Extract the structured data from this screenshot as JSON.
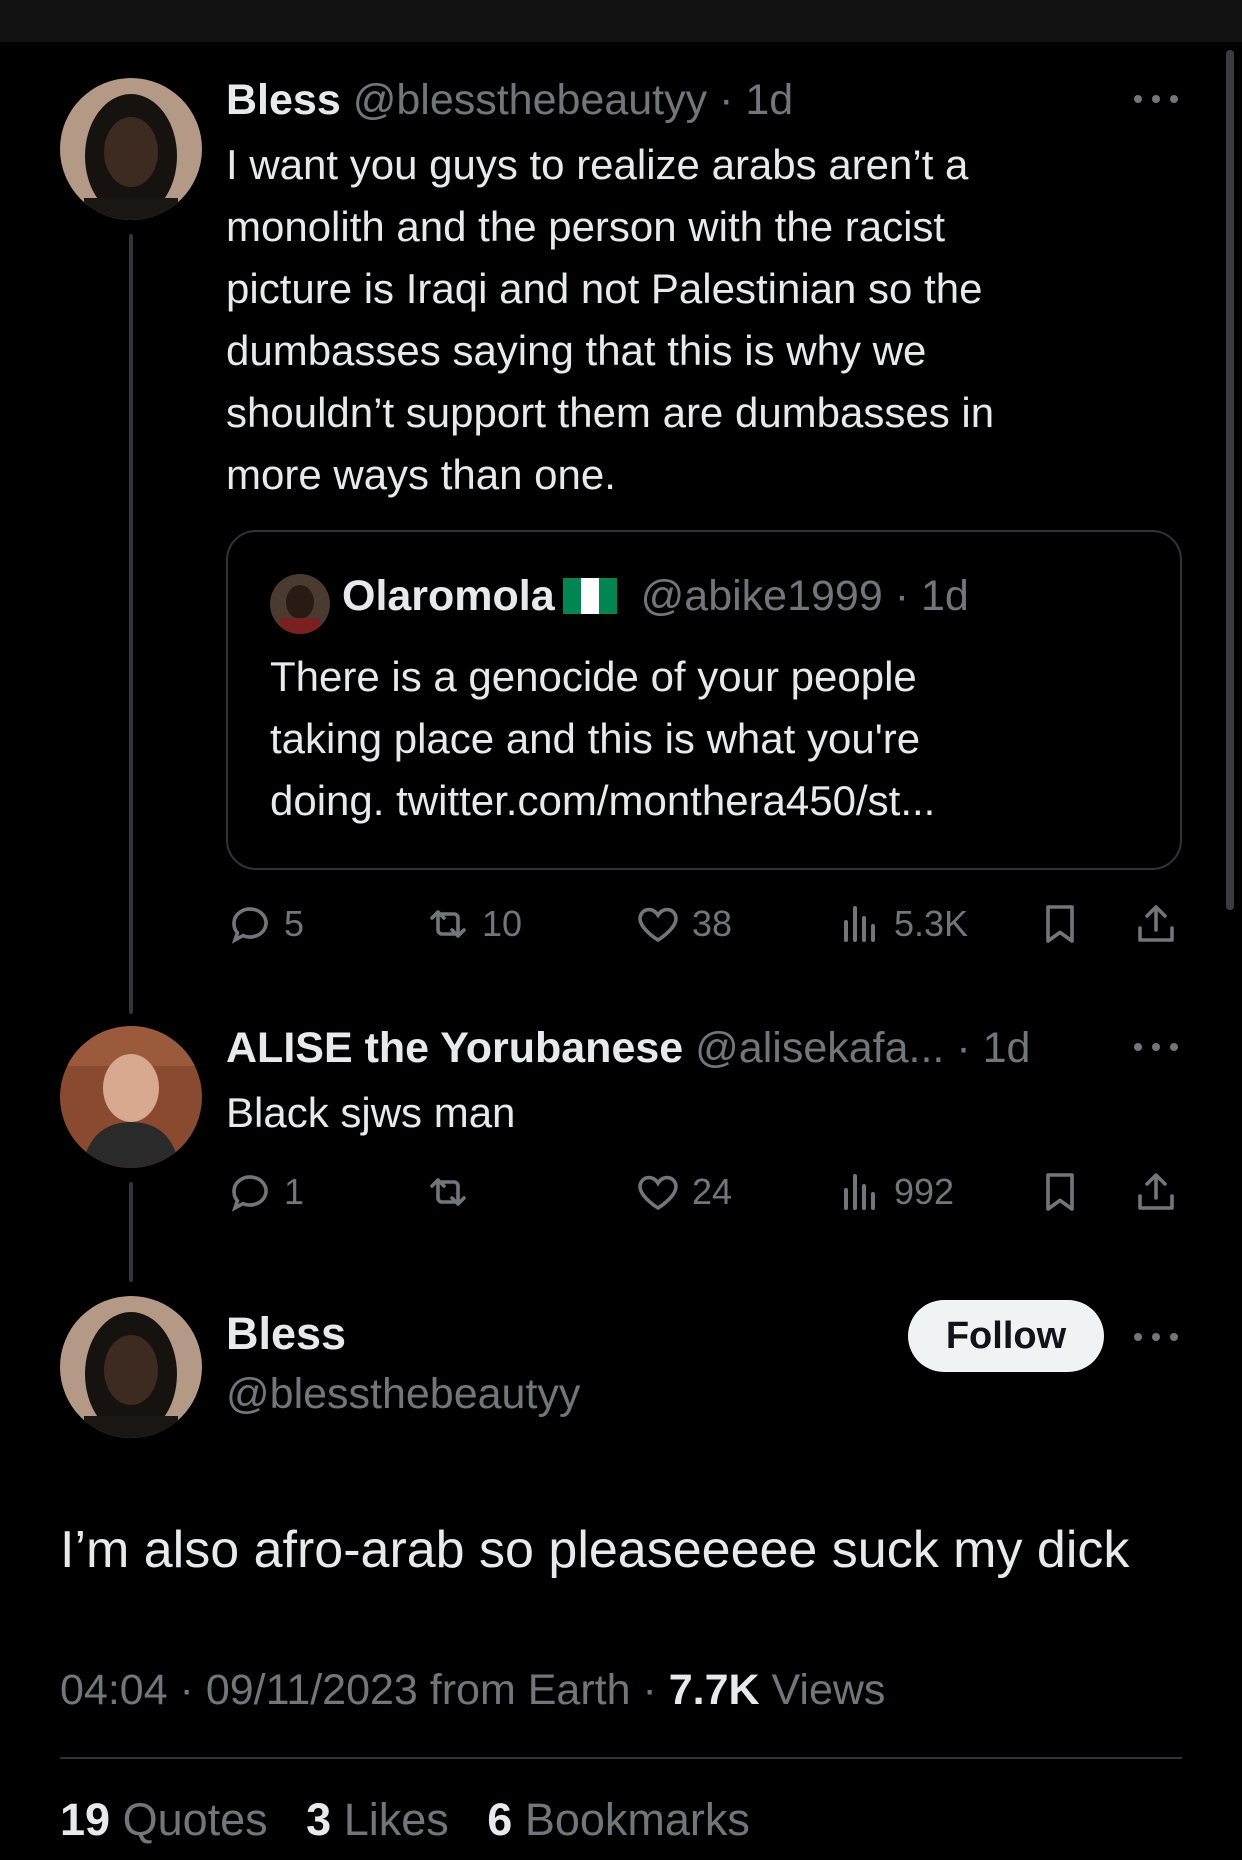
{
  "tweet1": {
    "name": "Bless",
    "handle": "@blessthebeautyy",
    "time": "· 1d",
    "text": "I want you guys to realize arabs aren’t a\nmonolith and the person with the racist\npicture is Iraqi and not Palestinian so the\ndumbasses saying that this is why we\nshouldn’t support them are dumbasses in\nmore ways than one.",
    "quote": {
      "name": "Olaromola",
      "handle": "@abike1999",
      "time": "· 1d",
      "text": "There is a genocide of your people\ntaking place and this is what you're\ndoing. twitter.com/monthera450/st..."
    },
    "replies": "5",
    "reposts": "10",
    "likes": "38",
    "views": "5.3K"
  },
  "tweet2": {
    "name": "ALISE the Yorubanese",
    "handle": "@alisekafa...",
    "time": "· 1d",
    "text": "Black sjws man",
    "replies": "1",
    "reposts": "",
    "likes": "24",
    "views": "992"
  },
  "main": {
    "name": "Bless",
    "handle": "@blessthebeautyy",
    "follow_label": "Follow",
    "text": "I’m also afro-arab so pleaseeeee suck my dick",
    "timestamp": "04:04 · 09/11/2023 from Earth · ",
    "views_count": "7.7K",
    "views_label": " Views",
    "stats": {
      "quotes_count": "19",
      "quotes_label": " Quotes",
      "likes_count": "3",
      "likes_label": " Likes",
      "bookmarks_count": "6",
      "bookmarks_label": " Bookmarks"
    }
  },
  "icons": {
    "more": "more-horizontal-icon",
    "reply": "reply-bubble-icon",
    "repost": "repost-arrows-icon",
    "like": "heart-icon",
    "views": "bar-chart-icon",
    "bookmark": "bookmark-icon",
    "share": "share-upload-icon"
  },
  "colors": {
    "background": "#000000",
    "text": "#e7e9ea",
    "muted": "#71767b",
    "border": "#2f3336"
  }
}
